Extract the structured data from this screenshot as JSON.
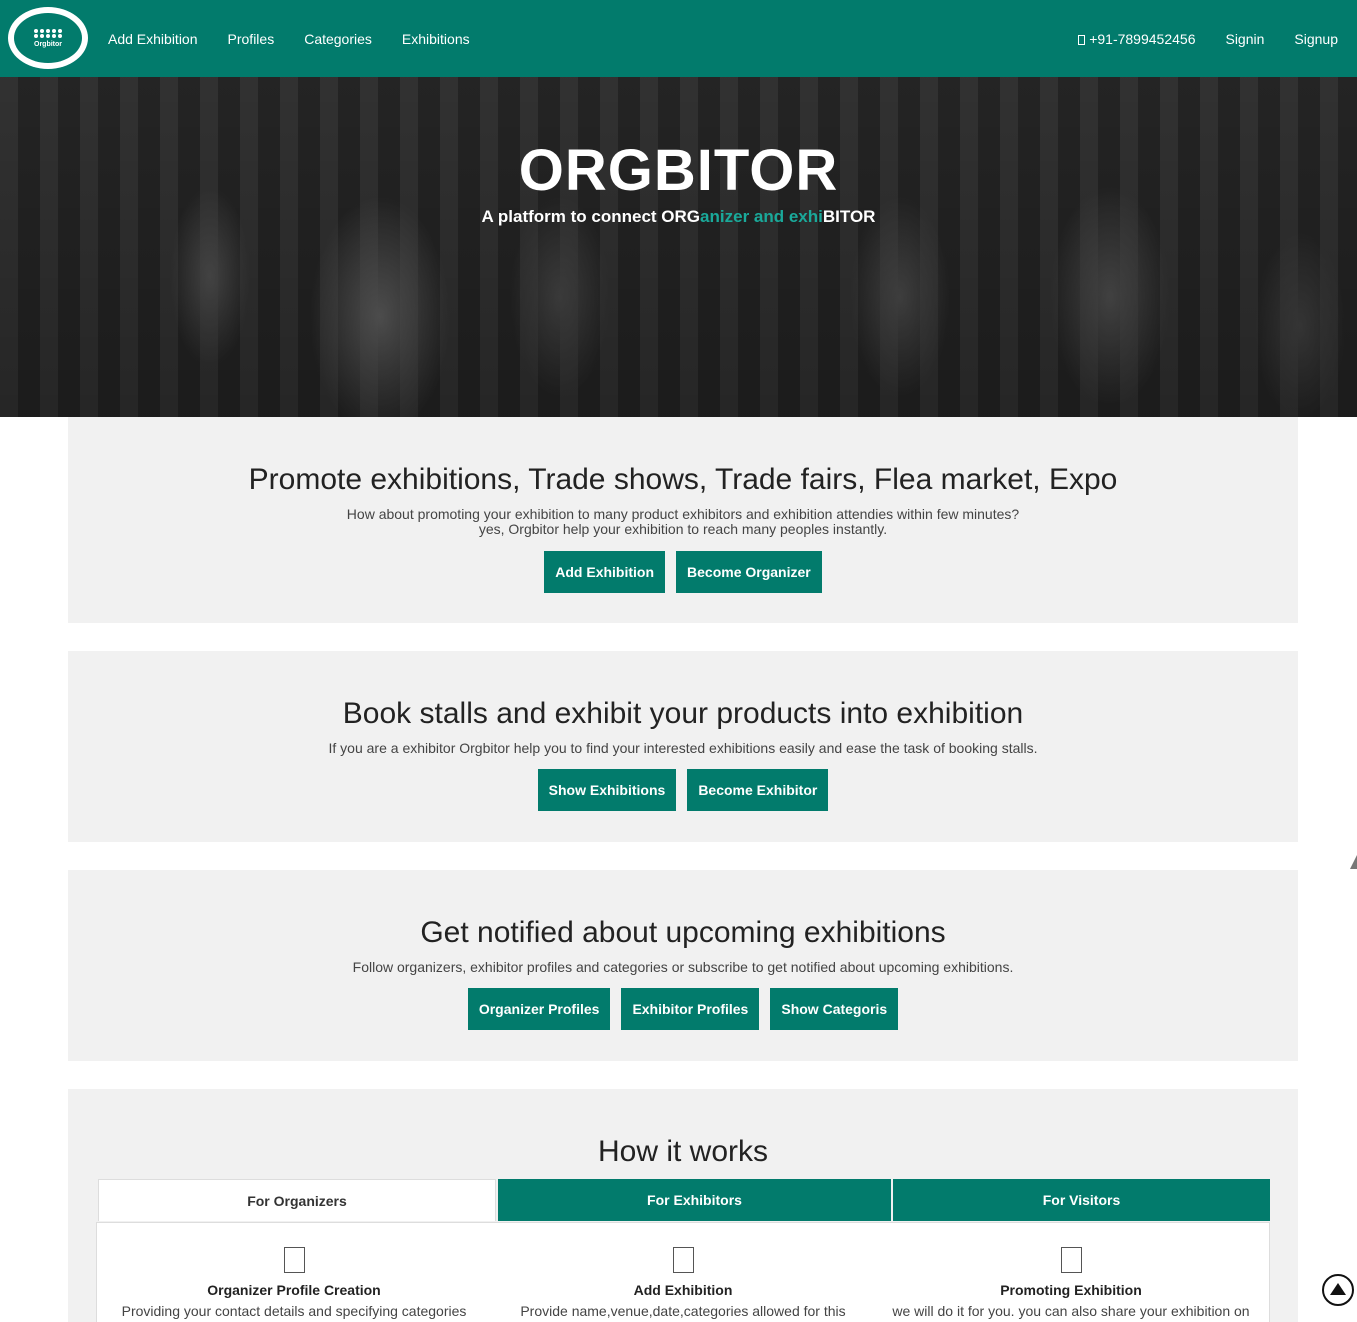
{
  "brand": {
    "logo_text": "Orgbitor"
  },
  "nav": {
    "left": [
      "Add Exhibition",
      "Profiles",
      "Categories",
      "Exhibitions"
    ],
    "phone": "+91-7899452456",
    "signin": "Signin",
    "signup": "Signup"
  },
  "hero": {
    "title": "ORGBITOR",
    "sub_part1": "A platform to connect ORG",
    "sub_part2": "anizer and exhi",
    "sub_part3": "BITOR",
    "accent_color": "#1aa99a"
  },
  "promote": {
    "heading": "Promote exhibitions, Trade shows, Trade fairs, Flea market, Expo",
    "line1": "How about promoting your exhibition to many product exhibitors and exhibition attendies within few minutes?",
    "line2": "yes, Orgbitor help your exhibition to reach many peoples instantly.",
    "buttons": [
      "Add Exhibition",
      "Become Organizer"
    ]
  },
  "book": {
    "heading": "Book stalls and exhibit your products into exhibition",
    "line": "If you are a exhibitor Orgbitor help you to find your interested exhibitions easily and ease the task of booking stalls.",
    "buttons": [
      "Show Exhibitions",
      "Become Exhibitor"
    ]
  },
  "notify": {
    "heading": "Get notified about upcoming exhibitions",
    "line": "Follow organizers, exhibitor profiles and categories or subscribe to get notified about upcoming exhibitions.",
    "buttons": [
      "Organizer Profiles",
      "Exhibitor Profiles",
      "Show Categoris"
    ]
  },
  "how": {
    "heading": "How it works",
    "tabs": [
      "For Organizers",
      "For Exhibitors",
      "For Visitors"
    ],
    "steps": [
      {
        "title": "Organizer Profile Creation",
        "desc": "Providing your contact details and specifying categories"
      },
      {
        "title": "Add Exhibition",
        "desc": "Provide name,venue,date,categories allowed for this"
      },
      {
        "title": "Promoting Exhibition",
        "desc": "we will do it for you. you can also share your exhibition on"
      }
    ]
  },
  "colors": {
    "primary": "#027b6c",
    "section_bg": "#f1f1f1"
  }
}
